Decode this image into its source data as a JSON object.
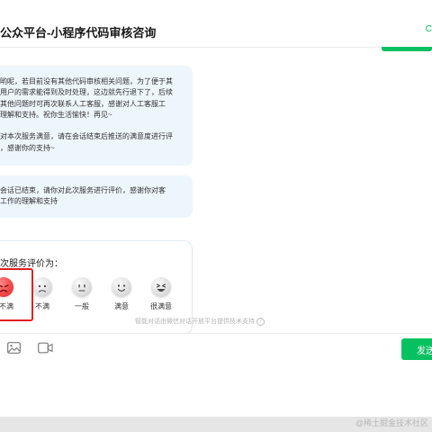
{
  "header": {
    "title": "公众平台-小程序代码审核咨询",
    "right_glyph": "C"
  },
  "messages": [
    {
      "lines": [
        "哟呢，若目前没有其他代码审核相关问题，为了便于其",
        "用户的需求能得到及时处理，这边就先行退下了，后续",
        "其他问题时可再次联系人工客服，感谢对人工客服工",
        "理解和支持。祝你生活愉快！再见~",
        "",
        "对本次服务满意，请在会话结束后推送的满意度进行评",
        "，感谢你的支持~"
      ]
    },
    {
      "lines": [
        "会话已结束，请你对此次服务进行评价，感谢你对客",
        "工作的理解和支持"
      ]
    }
  ],
  "rating": {
    "title": "次服务评价为：",
    "options": [
      {
        "label": "不满",
        "face": "very-unsatisfied",
        "selected": true
      },
      {
        "label": "不满",
        "face": "unsatisfied",
        "selected": false
      },
      {
        "label": "一般",
        "face": "neutral",
        "selected": false
      },
      {
        "label": "满意",
        "face": "satisfied",
        "selected": false
      },
      {
        "label": "很满意",
        "face": "very-satisfied",
        "selected": false
      }
    ],
    "footnote": "智能对话由微信对话开放平台提供技术支持",
    "footnote_icon": "?"
  },
  "toolbar": {
    "icons": [
      "image-icon",
      "video-icon"
    ],
    "send_label": "发送"
  },
  "watermark": "@稀土掘金技术社区",
  "colors": {
    "accent": "#07c160",
    "bubble": "#eef6fd",
    "highlight": "#e02020"
  }
}
